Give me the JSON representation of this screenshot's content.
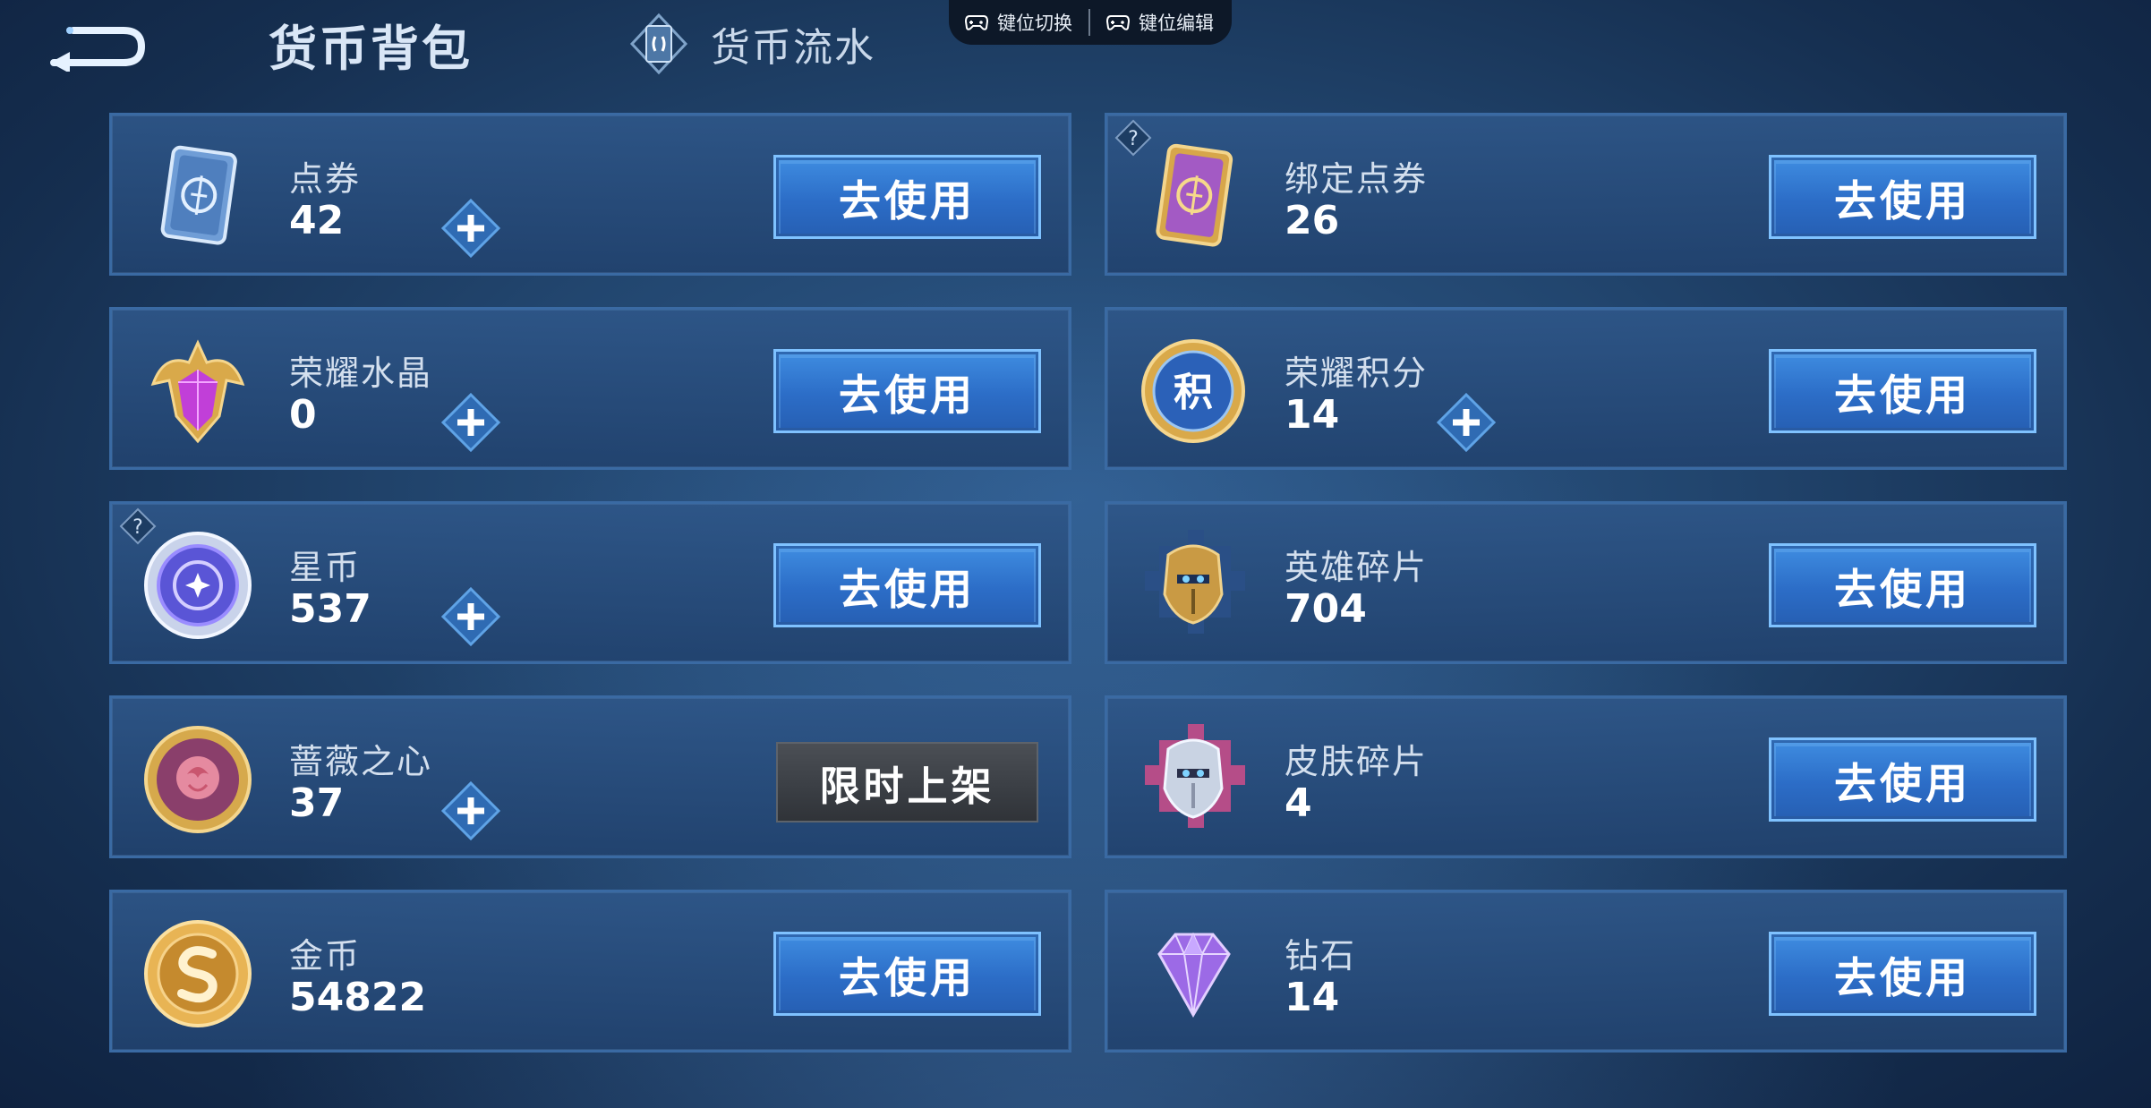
{
  "header": {
    "back_icon": "back-arrow-icon",
    "tabs": [
      {
        "label": "货币背包",
        "active": true
      },
      {
        "label": "货币流水",
        "active": false,
        "icon": "ledger-icon"
      }
    ]
  },
  "keybar": {
    "items": [
      {
        "label": "键位切换",
        "icon": "gamepad-icon"
      },
      {
        "label": "键位编辑",
        "icon": "gamepad-icon"
      }
    ]
  },
  "colors": {
    "accent_button": "#2c6dc7",
    "card_border": "#3a6aa3",
    "limited_button": "#3a3e44"
  },
  "currencies": [
    {
      "label": "点券",
      "value": "42",
      "button": "去使用",
      "icon": "coupon-card-icon",
      "has_plus": true,
      "has_help": false
    },
    {
      "label": "绑定点券",
      "value": "26",
      "button": "去使用",
      "icon": "bound-coupon-card-icon",
      "has_plus": false,
      "has_help": true
    },
    {
      "label": "荣耀水晶",
      "value": "0",
      "button": "去使用",
      "icon": "glory-crystal-icon",
      "has_plus": true,
      "has_help": false
    },
    {
      "label": "荣耀积分",
      "value": "14",
      "button": "去使用",
      "icon": "glory-points-icon",
      "has_plus": true,
      "has_help": false,
      "icon_text": "积"
    },
    {
      "label": "星币",
      "value": "537",
      "button": "去使用",
      "icon": "star-coin-icon",
      "has_plus": true,
      "has_help": true
    },
    {
      "label": "英雄碎片",
      "value": "704",
      "button": "去使用",
      "icon": "hero-fragment-icon",
      "has_plus": false,
      "has_help": false
    },
    {
      "label": "蔷薇之心",
      "value": "37",
      "button": "限时上架",
      "icon": "rose-heart-icon",
      "has_plus": true,
      "has_help": false
    },
    {
      "label": "皮肤碎片",
      "value": "4",
      "button": "去使用",
      "icon": "skin-fragment-icon",
      "has_plus": false,
      "has_help": false
    },
    {
      "label": "金币",
      "value": "54822",
      "button": "去使用",
      "icon": "gold-coin-icon",
      "has_plus": false,
      "has_help": false
    },
    {
      "label": "钻石",
      "value": "14",
      "button": "去使用",
      "icon": "diamond-icon",
      "has_plus": false,
      "has_help": false
    }
  ]
}
